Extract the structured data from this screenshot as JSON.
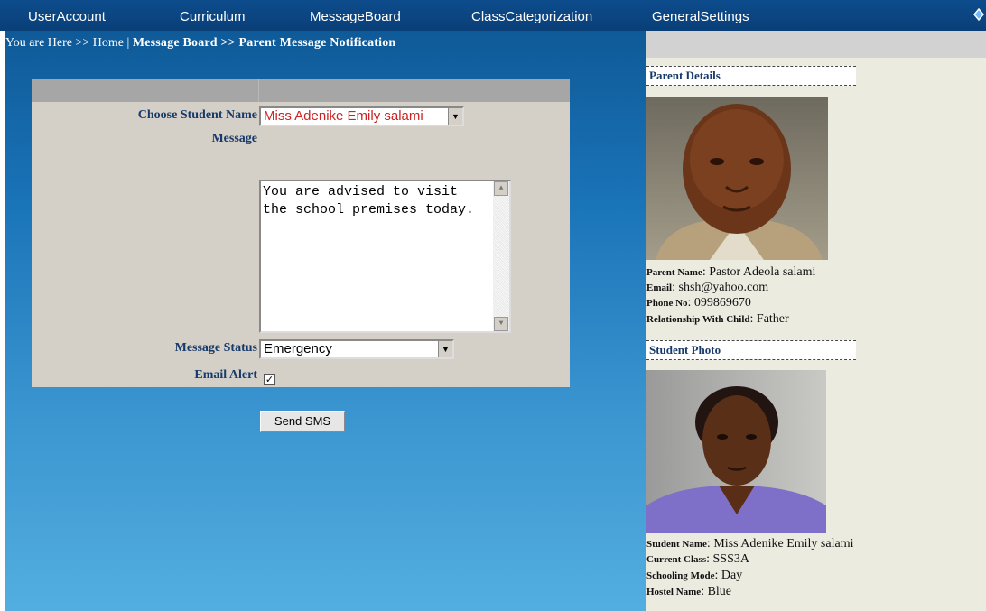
{
  "nav": {
    "items": [
      "UserAccount",
      "Curriculum",
      "MessageBoard",
      "ClassCategorization",
      "GeneralSettings"
    ]
  },
  "breadcrumb": {
    "prefix": "You are Here >> Home |",
    "current": "Message Board >> Parent Message Notification"
  },
  "form": {
    "student_label": "Choose Student Name",
    "student_value": "Miss Adenike Emily salami",
    "message_label": "Message",
    "message_value": "You are advised to visit the school premises today.",
    "status_label": "Message Status",
    "status_value": "Emergency",
    "email_alert_label": "Email Alert",
    "email_alert_checked": true,
    "submit_label": "Send SMS"
  },
  "parent": {
    "heading": "Parent Details",
    "name_label": "Parent Name",
    "name": "Pastor Adeola salami",
    "email_label": "Email",
    "email": "shsh@yahoo.com",
    "phone_label": "Phone No",
    "phone": "099869670",
    "relationship_label": "Relationship With Child",
    "relationship": "Father"
  },
  "student": {
    "heading": "Student Photo",
    "name_label": "Student Name",
    "name": "Miss Adenike Emily salami",
    "class_label": "Current Class",
    "class": "SSS3A",
    "mode_label": "Schooling Mode",
    "mode": "Day",
    "hostel_label": "Hostel Name",
    "hostel": "Blue"
  },
  "colors": {
    "nav_bg": "#0d4c8c",
    "label_text": "#173a6a",
    "select_red_text": "#cc2222",
    "panel_bg": "#d4d0c8",
    "sidebar_bg": "#ecebe0"
  }
}
